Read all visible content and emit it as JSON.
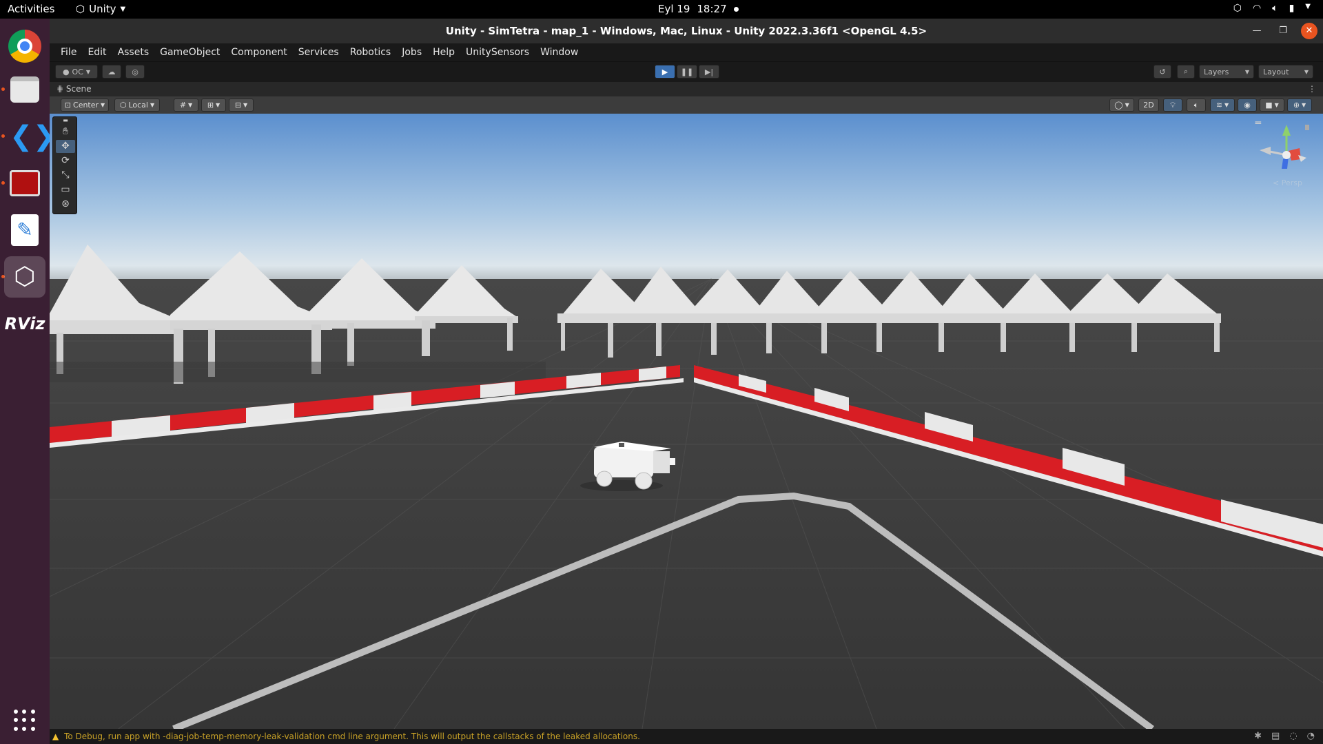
{
  "topbar": {
    "activities": "Activities",
    "app_name": "Unity",
    "date": "Eyl 19",
    "time": "18:27"
  },
  "dock": {
    "items": [
      "chrome-icon",
      "files-icon",
      "vscode-icon",
      "red-app-icon",
      "text-editor-icon",
      "unity-icon",
      "rviz-icon"
    ],
    "rviz_label": "RViz"
  },
  "window": {
    "title": "Unity - SimTetra - map_1 - Windows, Mac, Linux - Unity 2022.3.36f1 <OpenGL 4.5>"
  },
  "menubar": {
    "items": [
      "File",
      "Edit",
      "Assets",
      "GameObject",
      "Component",
      "Services",
      "Robotics",
      "Jobs",
      "Help",
      "UnitySensors",
      "Window"
    ]
  },
  "toolbar": {
    "account": "OC",
    "layers": "Layers",
    "layout": "Layout"
  },
  "scene": {
    "tab": "Scene",
    "pivot": "Center",
    "space": "Local",
    "mode_2d": "2D",
    "persp": "< Persp"
  },
  "statusbar": {
    "message": "To Debug, run app with -diag-job-temp-memory-leak-validation cmd line argument. This will output the callstacks of the leaked allocations."
  },
  "colors": {
    "accent": "#3a6fb0",
    "barrier_red": "#d81e24",
    "warning": "#c9a227",
    "dock_bg": "#3a1f33"
  }
}
